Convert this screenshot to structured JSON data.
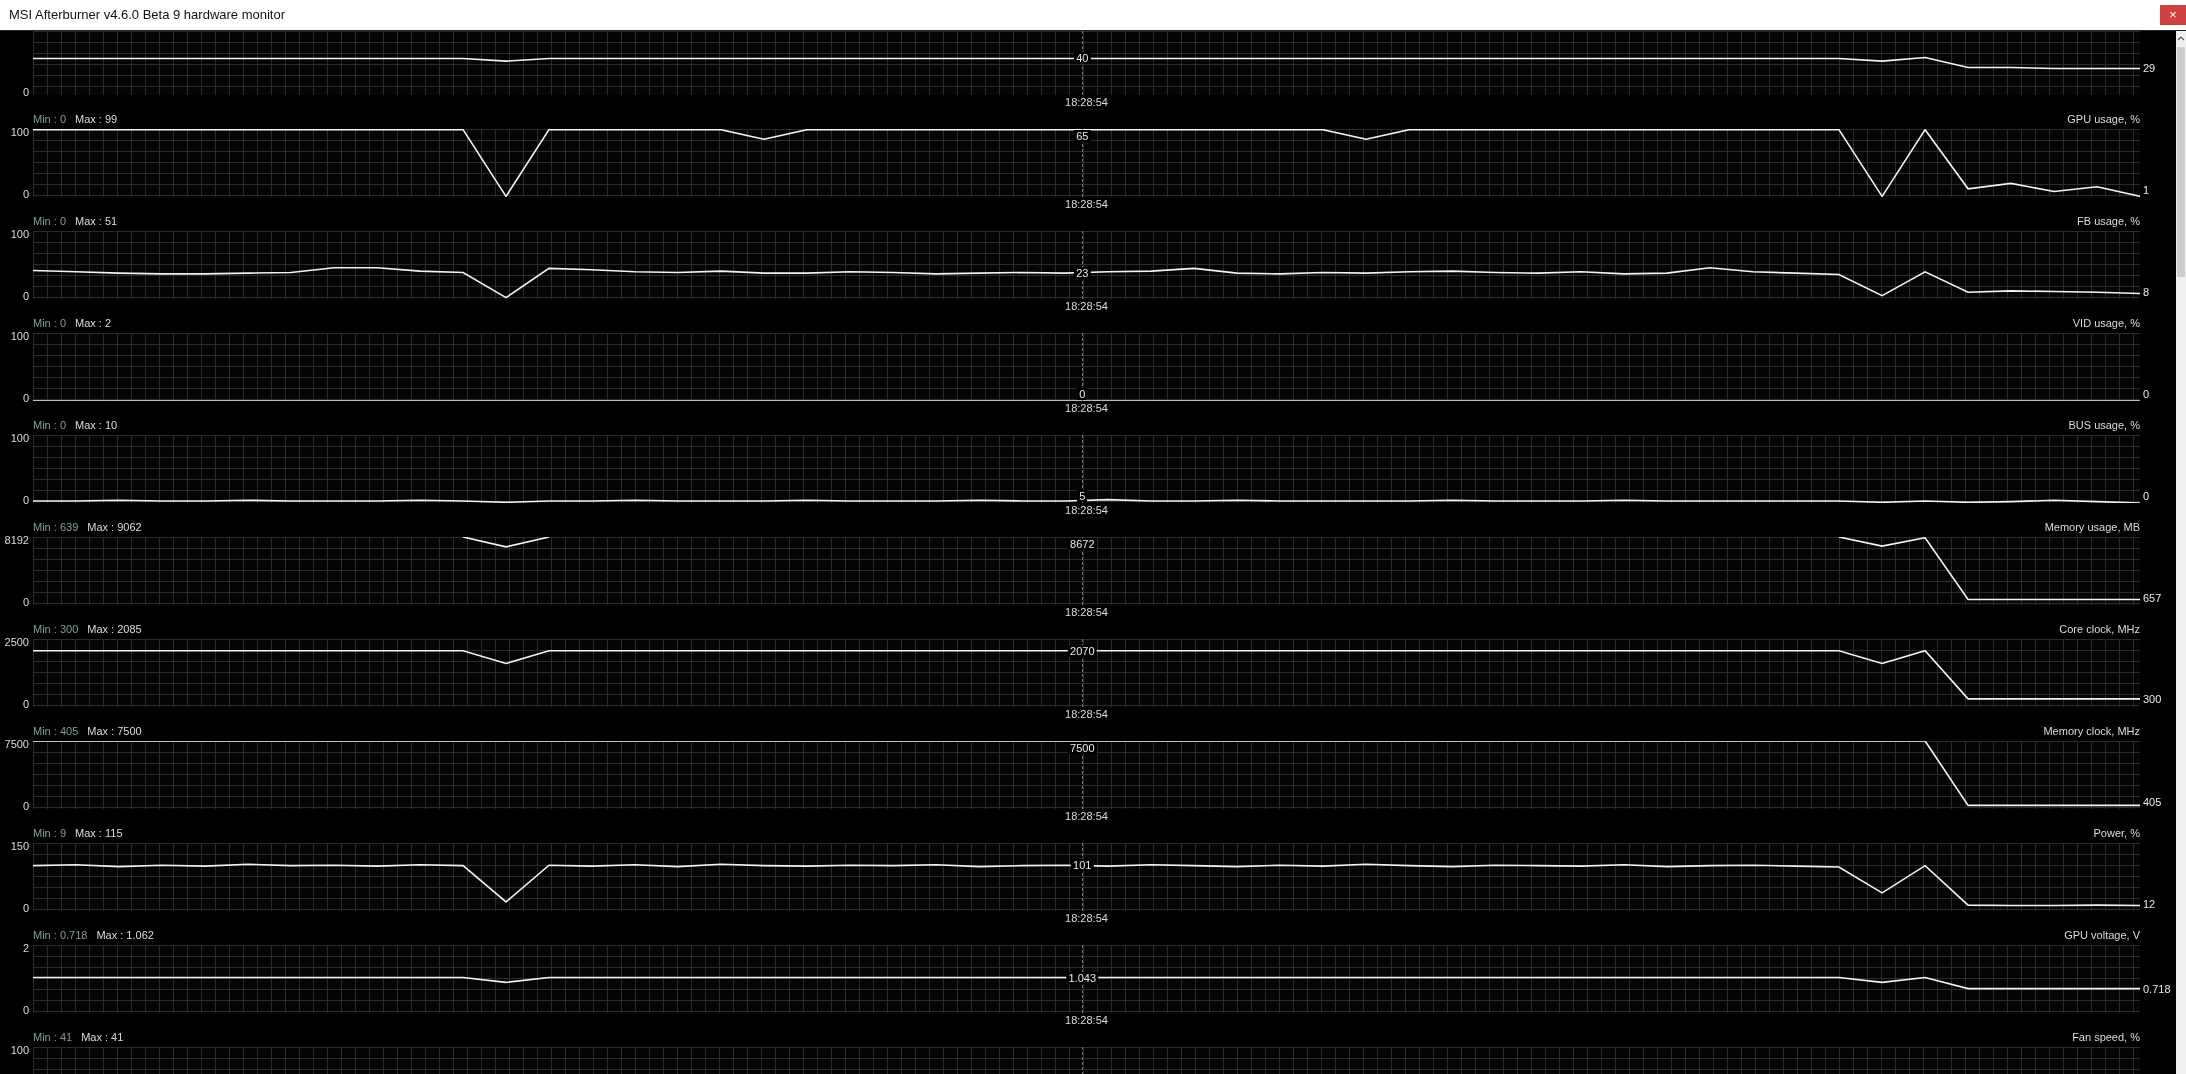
{
  "window": {
    "title": "MSI Afterburner v4.6.0 Beta 9 hardware monitor",
    "close_label": "×"
  },
  "graphs": [
    {
      "bottom_tick": "0",
      "cursor_value": "40",
      "cursor_time": "18:28:54",
      "end_value": "29"
    },
    {
      "min": "Min : 0",
      "max": "Max : 99",
      "name": "GPU usage, %",
      "top_tick": "100",
      "bottom_tick": "0",
      "cursor_value": "65",
      "cursor_time": "18:28:54",
      "end_value": "1"
    },
    {
      "min": "Min : 0",
      "max": "Max : 51",
      "name": "FB usage, %",
      "top_tick": "100",
      "bottom_tick": "0",
      "cursor_value": "23",
      "cursor_time": "18:28:54",
      "end_value": "8"
    },
    {
      "min": "Min : 0",
      "max": "Max : 2",
      "name": "VID usage, %",
      "top_tick": "100",
      "bottom_tick": "0",
      "cursor_value": "0",
      "cursor_time": "18:28:54",
      "end_value": "0"
    },
    {
      "min": "Min : 0",
      "max": "Max : 10",
      "name": "BUS usage, %",
      "top_tick": "100",
      "bottom_tick": "0",
      "cursor_value": "5",
      "cursor_time": "18:28:54",
      "end_value": "0"
    },
    {
      "min": "Min : 639",
      "max": "Max : 9062",
      "name": "Memory usage, MB",
      "top_tick": "8192",
      "bottom_tick": "0",
      "cursor_value": "8672",
      "cursor_time": "18:28:54",
      "end_value": "657"
    },
    {
      "min": "Min : 300",
      "max": "Max : 2085",
      "name": "Core clock, MHz",
      "top_tick": "2500",
      "bottom_tick": "0",
      "cursor_value": "2070",
      "cursor_time": "18:28:54",
      "end_value": "300"
    },
    {
      "min": "Min : 405",
      "max": "Max : 7500",
      "name": "Memory clock, MHz",
      "top_tick": "7500",
      "bottom_tick": "0",
      "cursor_value": "7500",
      "cursor_time": "18:28:54",
      "end_value": "405"
    },
    {
      "min": "Min : 9",
      "max": "Max : 115",
      "name": "Power, %",
      "top_tick": "150",
      "bottom_tick": "0",
      "cursor_value": "101",
      "cursor_time": "18:28:54",
      "end_value": "12"
    },
    {
      "min": "Min : 0.718",
      "max": "Max : 1.062",
      "name": "GPU voltage, V",
      "top_tick": "2",
      "bottom_tick": "0",
      "cursor_value": "1.043",
      "cursor_time": "18:28:54",
      "end_value": "0.718"
    },
    {
      "min": "Min : 41",
      "max": "Max : 41",
      "name": "Fan speed, %",
      "top_tick": "100"
    }
  ]
}
